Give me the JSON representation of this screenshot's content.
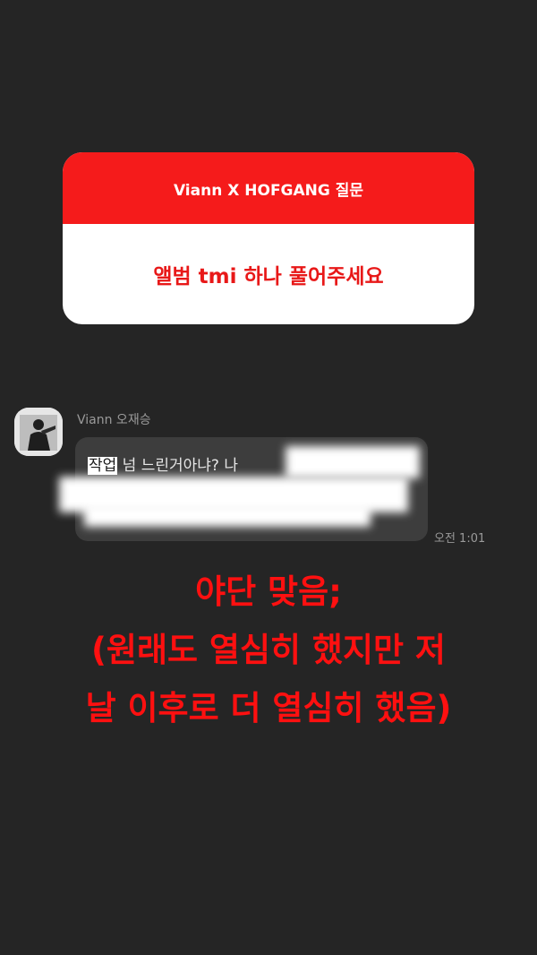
{
  "question_card": {
    "header": "Viann X HOFGANG 질문",
    "question": "앨범 tmi 하나 풀어주세요"
  },
  "chat": {
    "sender_name": "Viann 오재승",
    "message_highlighted": "작업",
    "message_visible": " 넘 느린거아냐? 나",
    "timestamp": "오전 1:01"
  },
  "caption": {
    "line1": "야단 맞음;",
    "line2": "(원래도 열심히 했지만 저",
    "line3": "날 이후로 더 열심히 했음)"
  },
  "colors": {
    "background": "#252525",
    "header_red": "#f51b1b",
    "caption_red": "#ff1010",
    "bubble": "#3d3d3d"
  }
}
